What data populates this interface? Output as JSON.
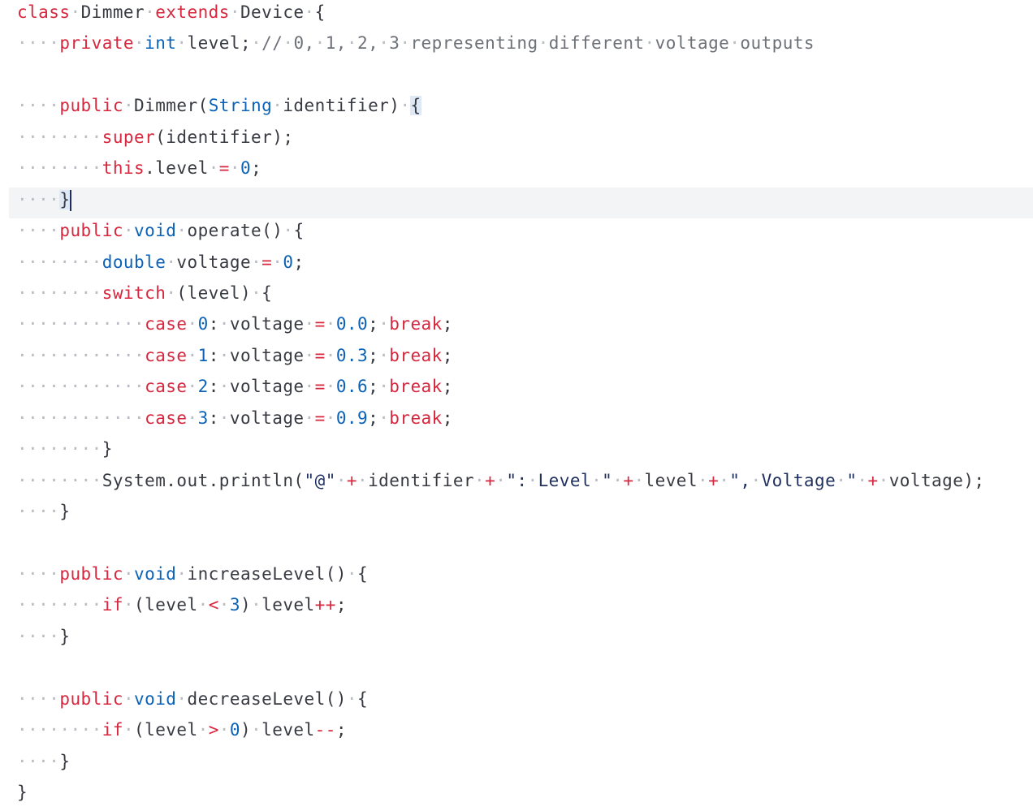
{
  "editor": {
    "language": "java",
    "lines": [
      "class·Dimmer·extends·Device·{",
      "····private·int·level;·//·0,·1,·2,·3·representing·different·voltage·outputs",
      "",
      "····public·Dimmer(String·identifier)·{",
      "········super(identifier);",
      "········this.level·=·0;",
      "····}",
      "····public·void·operate()·{",
      "········double·voltage·=·0;",
      "········switch·(level)·{",
      "············case·0:·voltage·=·0.0;·break;",
      "············case·1:·voltage·=·0.3;·break;",
      "············case·2:·voltage·=·0.6;·break;",
      "············case·3:·voltage·=·0.9;·break;",
      "········}",
      "········System.out.println(\"@\"·+·identifier·+·\":·Level·\"·+·level·+·\",·Voltage·\"·+·voltage);",
      "····}",
      "",
      "····public·void·increaseLevel()·{",
      "········if·(level·<·3)·level++;",
      "····}",
      "",
      "····public·void·decreaseLevel()·{",
      "········if·(level·>·0)·level--;",
      "····}",
      "}"
    ],
    "current_line": 7
  },
  "colors": {
    "keyword": "#d7263d",
    "type": "#0b62b7",
    "number": "#0b62b7",
    "operator": "#d7263d",
    "comment": "#6d7178",
    "string": "#1f2f5f",
    "whitespace_marker": "#b9bdc3",
    "text": "#383a42",
    "current_line_bg": "#f3f4f5",
    "bracket_match_bg": "#dfe8f5"
  }
}
